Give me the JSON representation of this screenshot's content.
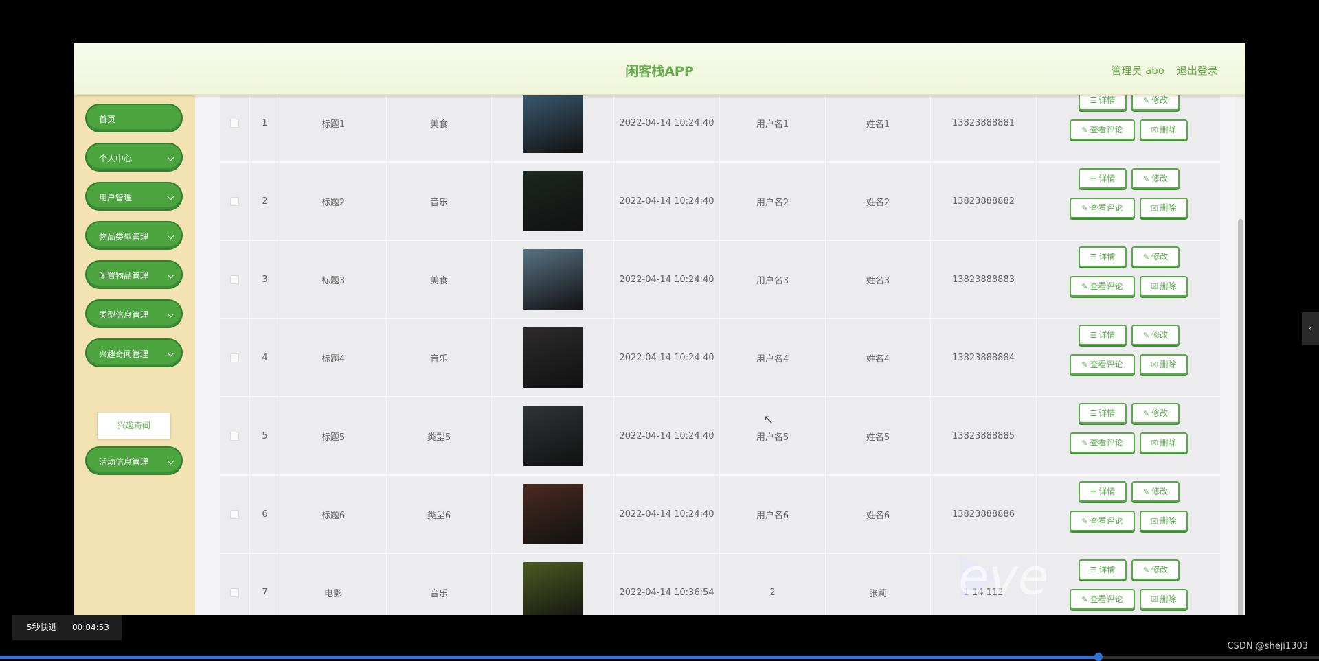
{
  "header": {
    "title": "闲客栈APP",
    "admin": "管理员 abo",
    "logout": "退出登录"
  },
  "sidebar": {
    "items": [
      {
        "label": "首页",
        "has_arrow": false
      },
      {
        "label": "个人中心",
        "has_arrow": true
      },
      {
        "label": "用户管理",
        "has_arrow": true
      },
      {
        "label": "物品类型管理",
        "has_arrow": true
      },
      {
        "label": "闲置物品管理",
        "has_arrow": true
      },
      {
        "label": "类型信息管理",
        "has_arrow": true
      },
      {
        "label": "兴趣奇闻管理",
        "has_arrow": true
      },
      {
        "label": "活动信息管理",
        "has_arrow": true
      }
    ],
    "submenu_item": "兴趣奇闻"
  },
  "table": {
    "rows": [
      {
        "index": "1",
        "title": "标题1",
        "type": "美食",
        "time": "2022-04-14 10:24:40",
        "username": "用户名1",
        "name": "姓名1",
        "phone": "13823888881",
        "thumb_color": "#3b5a72"
      },
      {
        "index": "2",
        "title": "标题2",
        "type": "音乐",
        "time": "2022-04-14 10:24:40",
        "username": "用户名2",
        "name": "姓名2",
        "phone": "13823888882",
        "thumb_color": "#1d2620"
      },
      {
        "index": "3",
        "title": "标题3",
        "type": "美食",
        "time": "2022-04-14 10:24:40",
        "username": "用户名3",
        "name": "姓名3",
        "phone": "13823888883",
        "thumb_color": "#587284"
      },
      {
        "index": "4",
        "title": "标题4",
        "type": "音乐",
        "time": "2022-04-14 10:24:40",
        "username": "用户名4",
        "name": "姓名4",
        "phone": "13823888884",
        "thumb_color": "#2d2b2b"
      },
      {
        "index": "5",
        "title": "标题5",
        "type": "类型5",
        "time": "2022-04-14 10:24:40",
        "username": "用户名5",
        "name": "姓名5",
        "phone": "13823888885",
        "thumb_color": "#2f3436"
      },
      {
        "index": "6",
        "title": "标题6",
        "type": "类型6",
        "time": "2022-04-14 10:24:40",
        "username": "用户名6",
        "name": "姓名6",
        "phone": "13823888886",
        "thumb_color": "#4a2a20"
      },
      {
        "index": "7",
        "title": "电影",
        "type": "音乐",
        "time": "2022-04-14 10:36:54",
        "username": "2",
        "name": "张莉",
        "phone": "1  14    112",
        "thumb_color": "#4d5a20"
      }
    ],
    "actions": {
      "detail": "详情",
      "edit": "修改",
      "comments": "查看评论",
      "delete": "删除"
    }
  },
  "overlay": {
    "skip_label": "5秒快进",
    "time": "00:04:53",
    "credit": "CSDN @sheji1303",
    "watermark": "eve",
    "progress": 0.833
  },
  "icons": {
    "detail": "document-icon",
    "edit": "pencil-icon",
    "comments": "pencil-icon",
    "delete": "trash-icon",
    "chevron": "chevron-down-icon",
    "side_toggle": "chevron-left-icon"
  },
  "colors": {
    "accent": "#4da540",
    "sidebar_bg": "#f3e3b3",
    "header_bg": "#f4f9e4",
    "progress": "#2b73d9"
  }
}
